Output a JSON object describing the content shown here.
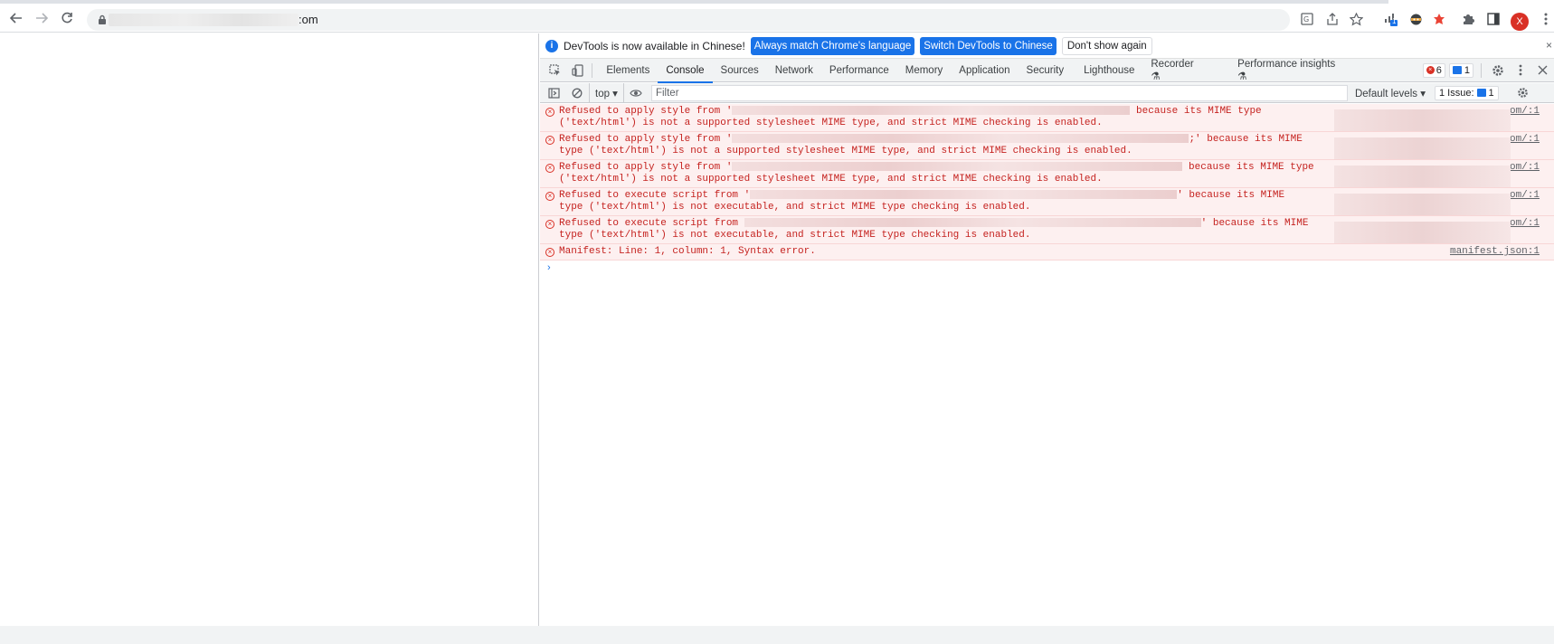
{
  "browser": {
    "url_suffix": ":om",
    "avatar_letter": "X",
    "extension_badge": "1"
  },
  "infobar": {
    "message": "DevTools is now available in Chinese!",
    "btn_match": "Always match Chrome's language",
    "btn_switch": "Switch DevTools to Chinese",
    "btn_dismiss": "Don't show again",
    "close": "×"
  },
  "tabs": [
    "Elements",
    "Console",
    "Sources",
    "Network",
    "Performance",
    "Memory",
    "Application",
    "Security",
    "Lighthouse",
    "Recorder ⚗",
    "Performance insights ⚗"
  ],
  "active_tab": "Console",
  "counts": {
    "errors": "6",
    "messages": "1"
  },
  "console_toolbar": {
    "context": "top ▾",
    "filter_placeholder": "Filter",
    "levels": "Default levels ▾",
    "issues_label": "1 Issue:",
    "issues_count": "1"
  },
  "logs": [
    {
      "line1_pre": "Refused to apply style from '",
      "line1_post": " because its MIME type",
      "line2": "('text/html') is not a supported stylesheet MIME type, and strict MIME checking is enabled.",
      "source": "om/:1"
    },
    {
      "line1_pre": "Refused to apply style from '",
      "line1_post": ";' because its MIME",
      "line2": "type ('text/html') is not a supported stylesheet MIME type, and strict MIME checking is enabled.",
      "source": "om/:1"
    },
    {
      "line1_pre": "Refused to apply style from '",
      "line1_post": " because its MIME type",
      "line2": "('text/html') is not a supported stylesheet MIME type, and strict MIME checking is enabled.",
      "source": "om/:1"
    },
    {
      "line1_pre": "Refused to execute script from '",
      "line1_post": "' because its MIME",
      "line2": "type ('text/html') is not executable, and strict MIME type checking is enabled.",
      "source": "om/:1"
    },
    {
      "line1_pre": "Refused to execute script from ",
      "line1_post": "' because its MIME",
      "line2": "type ('text/html') is not executable, and strict MIME type checking is enabled.",
      "source": "om/:1"
    }
  ],
  "manifest_log": {
    "text": "Manifest: Line: 1, column: 1, Syntax error.",
    "source": "manifest.json:1"
  },
  "prompt": "›"
}
